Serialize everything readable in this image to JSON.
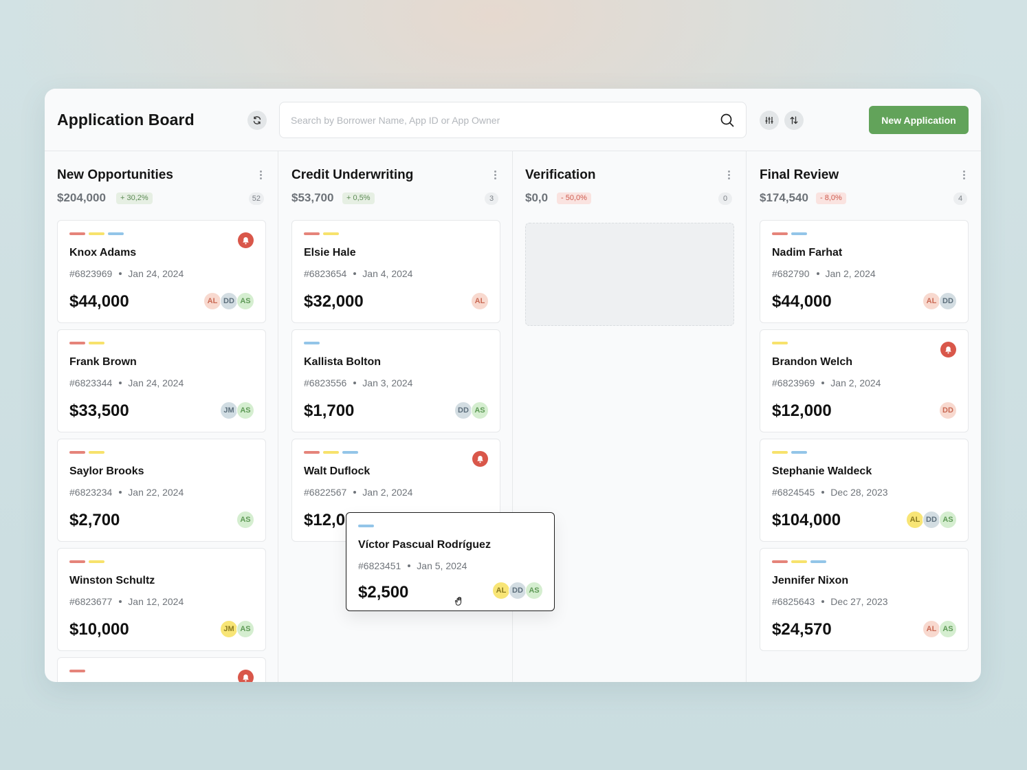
{
  "app": {
    "title": "Application Board",
    "new_button": "New Application",
    "search_placeholder": "Search by Borrower Name, App ID or App Owner"
  },
  "colors": {
    "accent_green": "#62a35a",
    "alert_red": "#d9574a",
    "tag_red": "#e5847a",
    "tag_yellow": "#f7e26c",
    "tag_blue": "#93c5e8"
  },
  "columns": [
    {
      "title": "New Opportunities",
      "amount": "$204,000",
      "change": "+ 30,2%",
      "trend": "up",
      "count": "52",
      "cards": [
        {
          "name": "Knox Adams",
          "id": "#6823969",
          "date": "Jan 24, 2024",
          "amount": "$44,000",
          "alert": true,
          "tags": [
            "red",
            "yellow",
            "blue"
          ],
          "owners": [
            "AL",
            "DD",
            "AS"
          ]
        },
        {
          "name": "Frank Brown",
          "id": "#6823344",
          "date": "Jan 24, 2024",
          "amount": "$33,500",
          "alert": false,
          "tags": [
            "red",
            "yellow"
          ],
          "owners": [
            "JM",
            "AS"
          ]
        },
        {
          "name": "Saylor Brooks",
          "id": "#6823234",
          "date": "Jan 22, 2024",
          "amount": "$2,700",
          "alert": false,
          "tags": [
            "red",
            "yellow"
          ],
          "owners": [
            "AS"
          ]
        },
        {
          "name": "Winston Schultz",
          "id": "#6823677",
          "date": "Jan 12, 2024",
          "amount": "$10,000",
          "alert": false,
          "tags": [
            "red",
            "yellow"
          ],
          "owners": [
            "JM",
            "AS"
          ]
        }
      ]
    },
    {
      "title": "Credit Underwriting",
      "amount": "$53,700",
      "change": "+ 0,5%",
      "trend": "up",
      "count": "3",
      "cards": [
        {
          "name": "Elsie Hale",
          "id": "#6823654",
          "date": "Jan 4, 2024",
          "amount": "$32,000",
          "alert": false,
          "tags": [
            "red",
            "yellow"
          ],
          "owners": [
            "AL"
          ]
        },
        {
          "name": "Kallista Bolton",
          "id": "#6823556",
          "date": "Jan 3, 2024",
          "amount": "$1,700",
          "alert": false,
          "tags": [
            "blue"
          ],
          "owners": [
            "DD",
            "AS"
          ]
        },
        {
          "name": "Walt Duflock",
          "id": "#6822567",
          "date": "Jan 2, 2024",
          "amount": "$12,0",
          "alert": true,
          "tags": [
            "red",
            "yellow",
            "blue"
          ],
          "owners": []
        }
      ]
    },
    {
      "title": "Verification",
      "amount": "$0,0",
      "change": "- 50,0%",
      "trend": "down",
      "count": "0",
      "cards": []
    },
    {
      "title": "Final Review",
      "amount": "$174,540",
      "change": "- 8,0%",
      "trend": "down",
      "count": "4",
      "cards": [
        {
          "name": "Nadim Farhat",
          "id": "#682790",
          "date": "Jan 2, 2024",
          "amount": "$44,000",
          "alert": false,
          "tags": [
            "red",
            "blue"
          ],
          "owners": [
            "AL",
            "DD"
          ]
        },
        {
          "name": "Brandon Welch",
          "id": "#6823969",
          "date": "Jan 2, 2024",
          "amount": "$12,000",
          "alert": true,
          "tags": [
            "yellow"
          ],
          "owners": [
            "DD"
          ]
        },
        {
          "name": "Stephanie Waldeck",
          "id": "#6824545",
          "date": "Dec 28, 2023",
          "amount": "$104,000",
          "alert": false,
          "tags": [
            "yellow",
            "blue"
          ],
          "owners": [
            "AL",
            "DD",
            "AS"
          ]
        },
        {
          "name": "Jennifer Nixon",
          "id": "#6825643",
          "date": "Dec 27, 2023",
          "amount": "$24,570",
          "alert": false,
          "tags": [
            "red",
            "yellow",
            "blue"
          ],
          "owners": [
            "AL",
            "AS"
          ]
        }
      ]
    }
  ],
  "dragging_card": {
    "name": "Víctor Pascual Rodríguez",
    "id": "#6823451",
    "date": "Jan 5, 2024",
    "amount": "$2,500",
    "tags": [
      "blue"
    ],
    "owners": [
      "AL",
      "DD",
      "AS"
    ]
  }
}
